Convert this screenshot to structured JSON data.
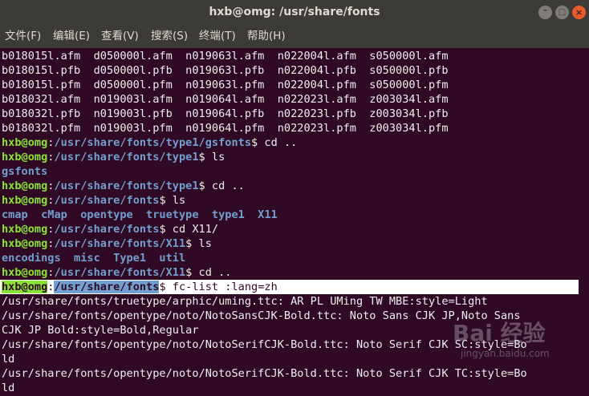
{
  "window": {
    "title": "hxb@omg: /usr/share/fonts",
    "buttons": {
      "minimize": "–",
      "maximize": "□",
      "close": "×"
    }
  },
  "menu": [
    "文件(F)",
    "编辑(E)",
    "查看(V)",
    "搜索(S)",
    "终端(T)",
    "帮助(H)"
  ],
  "terminal": {
    "file_rows": [
      "b018015l.afm  d050000l.afm  n019063l.afm  n022004l.afm  s050000l.afm",
      "b018015l.pfb  d050000l.pfb  n019063l.pfb  n022004l.pfb  s050000l.pfb",
      "b018015l.pfm  d050000l.pfm  n019063l.pfm  n022004l.pfm  s050000l.pfm",
      "b018032l.afm  n019003l.afm  n019064l.afm  n022023l.afm  z003034l.afm",
      "b018032l.pfb  n019003l.pfb  n019064l.pfb  n022023l.pfb  z003034l.pfb",
      "b018032l.pfm  n019003l.pfm  n019064l.pfm  n022023l.pfm  z003034l.pfm"
    ],
    "user_host": "hxb@omg",
    "prompts": [
      {
        "path": "/usr/share/fonts/type1/gsfonts",
        "cmd": " cd .."
      },
      {
        "path": "/usr/share/fonts/type1",
        "cmd": " ls"
      },
      {
        "path": "/usr/share/fonts/type1",
        "cmd": " cd .."
      },
      {
        "path": "/usr/share/fonts",
        "cmd": " ls"
      },
      {
        "path": "/usr/share/fonts",
        "cmd": " cd X11/"
      },
      {
        "path": "/usr/share/fonts/X11",
        "cmd": " ls"
      },
      {
        "path": "/usr/share/fonts/X11",
        "cmd": " cd .."
      },
      {
        "path": "/usr/share/fonts",
        "cmd": " fc-list :lang=zh"
      }
    ],
    "ls_type1": "gsfonts",
    "ls_fonts": "cmap  cMap  opentype  truetype  type1  X11",
    "ls_x11": "encodings  misc  Type1  util",
    "output": [
      "/usr/share/fonts/truetype/arphic/uming.ttc: AR PL UMing TW MBE:style=Light",
      "/usr/share/fonts/opentype/noto/NotoSansCJK-Bold.ttc: Noto Sans CJK JP,Noto Sans",
      "CJK JP Bold:style=Bold,Regular",
      "/usr/share/fonts/opentype/noto/NotoSerifCJK-Bold.ttc: Noto Serif CJK SC:style=Bo",
      "ld",
      "/usr/share/fonts/opentype/noto/NotoSerifCJK-Bold.ttc: Noto Serif CJK TC:style=Bo",
      "ld"
    ]
  },
  "watermark": {
    "brand": "Bai 经验",
    "sub": "jingyan.baidu.com"
  }
}
